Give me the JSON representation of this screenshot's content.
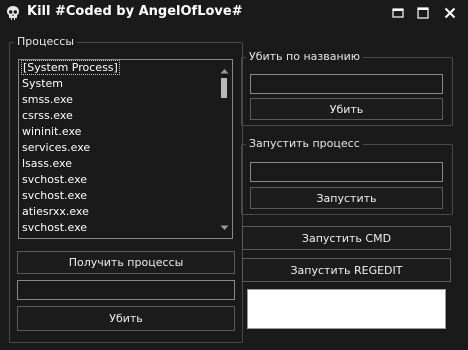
{
  "window": {
    "title": "Kill #Coded by AngelOfLove#",
    "icons": [
      "skull-app-icon",
      "minimize-icon",
      "maximize-icon",
      "close-icon"
    ]
  },
  "processes_group": {
    "legend": "Процессы",
    "items": [
      "[System Process]",
      "System",
      "smss.exe",
      "csrss.exe",
      "wininit.exe",
      "services.exe",
      "lsass.exe",
      "svchost.exe",
      "svchost.exe",
      "atiesrxx.exe",
      "svchost.exe",
      "svchost.exe"
    ],
    "get_processes_label": "Получить процессы",
    "kill_input_value": "",
    "kill_label": "Убить"
  },
  "kill_by_name_group": {
    "legend": "Убить по названию",
    "name_value": "",
    "kill_label": "Убить"
  },
  "start_process_group": {
    "legend": "Запустить процесс",
    "path_value": "",
    "start_label": "Запустить"
  },
  "run_cmd_label": "Запустить CMD",
  "run_regedit_label": "Запустить REGEDIT"
}
